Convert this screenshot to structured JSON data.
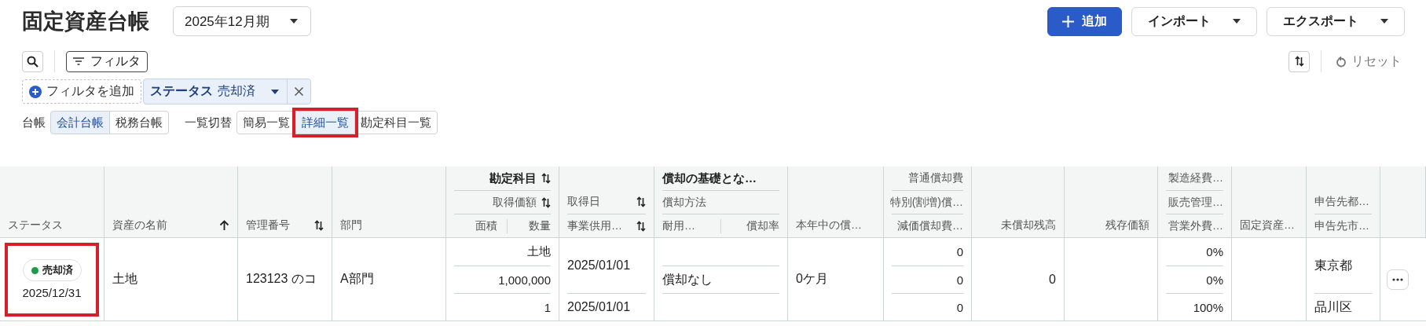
{
  "title": "固定資産台帳",
  "period": {
    "value": "2025年12月期"
  },
  "actions": [
    {
      "kind": "primary",
      "label": "追加"
    },
    {
      "kind": "menu",
      "label": "インポート"
    },
    {
      "kind": "menu",
      "label": "エクスポート"
    }
  ],
  "toolbar": {
    "filter_label": "フィルタ",
    "reset_label": "リセット"
  },
  "filters": {
    "add_label": "フィルタを追加",
    "chips": [
      {
        "name": "ステータス",
        "value": "売却済"
      }
    ]
  },
  "switchers": [
    {
      "label": "台帳",
      "options": [
        {
          "label": "会計台帳",
          "selected": true,
          "highlighted": false
        },
        {
          "label": "税務台帳",
          "selected": false,
          "highlighted": false
        }
      ]
    },
    {
      "label": "一覧切替",
      "options": [
        {
          "label": "簡易一覧",
          "selected": false,
          "highlighted": false
        },
        {
          "label": "詳細一覧",
          "selected": true,
          "highlighted": true
        },
        {
          "label": "勘定科目一覧",
          "selected": false,
          "highlighted": false
        }
      ]
    }
  ],
  "table": {
    "columns": [
      {
        "kind": "single",
        "label": "ステータス",
        "numeric": false
      },
      {
        "kind": "single",
        "label": "資産の名前",
        "numeric": false,
        "sort_icon": {
          "kind": "ascending"
        }
      },
      {
        "kind": "single",
        "label": "管理番号",
        "numeric": false,
        "sort_icon": {
          "kind": "unsorted"
        }
      },
      {
        "kind": "single",
        "label": "部門",
        "numeric": false
      },
      {
        "kind": "stack",
        "numeric": true,
        "lines": [
          {
            "parts": [
              "勘定科目"
            ],
            "bold": true,
            "sort_icon": {
              "kind": "unsorted"
            }
          },
          {
            "parts": [
              "取得価額"
            ],
            "bold": false,
            "sort_icon": {
              "kind": "unsorted"
            }
          },
          {
            "parts": [
              "面積",
              "数量"
            ],
            "bold": false
          }
        ]
      },
      {
        "kind": "stack",
        "numeric": false,
        "lines": [
          {
            "parts": [
              "取得日"
            ],
            "bold": false,
            "sort_icon": {
              "kind": "unsorted"
            }
          },
          {
            "parts": [
              "事業供用…"
            ],
            "bold": false,
            "sort_icon": {
              "kind": "unsorted"
            }
          }
        ]
      },
      {
        "kind": "stack",
        "numeric": false,
        "lines": [
          {
            "parts": [
              "償却の基礎とな…"
            ],
            "bold": true
          },
          {
            "parts": [
              "償却方法"
            ],
            "bold": false
          },
          {
            "parts": [
              "耐用…",
              "償却率"
            ],
            "bold": false
          }
        ]
      },
      {
        "kind": "single",
        "label": "本年中の償…",
        "numeric": false
      },
      {
        "kind": "stack",
        "numeric": true,
        "lines": [
          {
            "parts": [
              "普通償却費"
            ],
            "bold": false
          },
          {
            "parts": [
              "特別(割増)償…"
            ],
            "bold": false
          },
          {
            "parts": [
              "減価償却費…"
            ],
            "bold": false
          }
        ]
      },
      {
        "kind": "single",
        "label": "未償却残高",
        "numeric": true
      },
      {
        "kind": "single",
        "label": "残存価額",
        "numeric": true
      },
      {
        "kind": "stack",
        "numeric": true,
        "lines": [
          {
            "parts": [
              "製造経費…"
            ],
            "bold": false
          },
          {
            "parts": [
              "販売管理…"
            ],
            "bold": false
          },
          {
            "parts": [
              "営業外費…"
            ],
            "bold": false
          }
        ]
      },
      {
        "kind": "single",
        "label": "固定資産…",
        "numeric": false
      },
      {
        "kind": "stack",
        "numeric": false,
        "lines": [
          {
            "parts": [
              "申告先都…"
            ],
            "bold": false
          },
          {
            "parts": [
              "申告先市…"
            ],
            "bold": false
          }
        ]
      },
      {
        "kind": "empty"
      }
    ],
    "rows": [
      {
        "cells": [
          {
            "kind": "status",
            "badge": "売却済",
            "color": "#1e9b48",
            "date": "2025/12/31",
            "highlighted": true
          },
          {
            "kind": "center",
            "text": "土地"
          },
          {
            "kind": "center",
            "text": "123123 のコ"
          },
          {
            "kind": "center",
            "text": "A部門"
          },
          {
            "kind": "stack",
            "lines": [
              "土地",
              "1,000,000",
              "1"
            ]
          },
          {
            "kind": "pair",
            "lines": [
              "2025/01/01",
              "2025/01/01"
            ]
          },
          {
            "kind": "middle",
            "text": "償却なし"
          },
          {
            "kind": "center",
            "text": "0ケ月"
          },
          {
            "kind": "stack",
            "lines": [
              "0",
              "0",
              "0"
            ]
          },
          {
            "kind": "center",
            "text": "0"
          },
          {
            "kind": "empty"
          },
          {
            "kind": "stack",
            "lines": [
              "0%",
              "0%",
              "100%"
            ]
          },
          {
            "kind": "empty"
          },
          {
            "kind": "pair",
            "lines": [
              "東京都",
              "品川区"
            ]
          },
          {
            "kind": "menu"
          }
        ]
      }
    ]
  }
}
